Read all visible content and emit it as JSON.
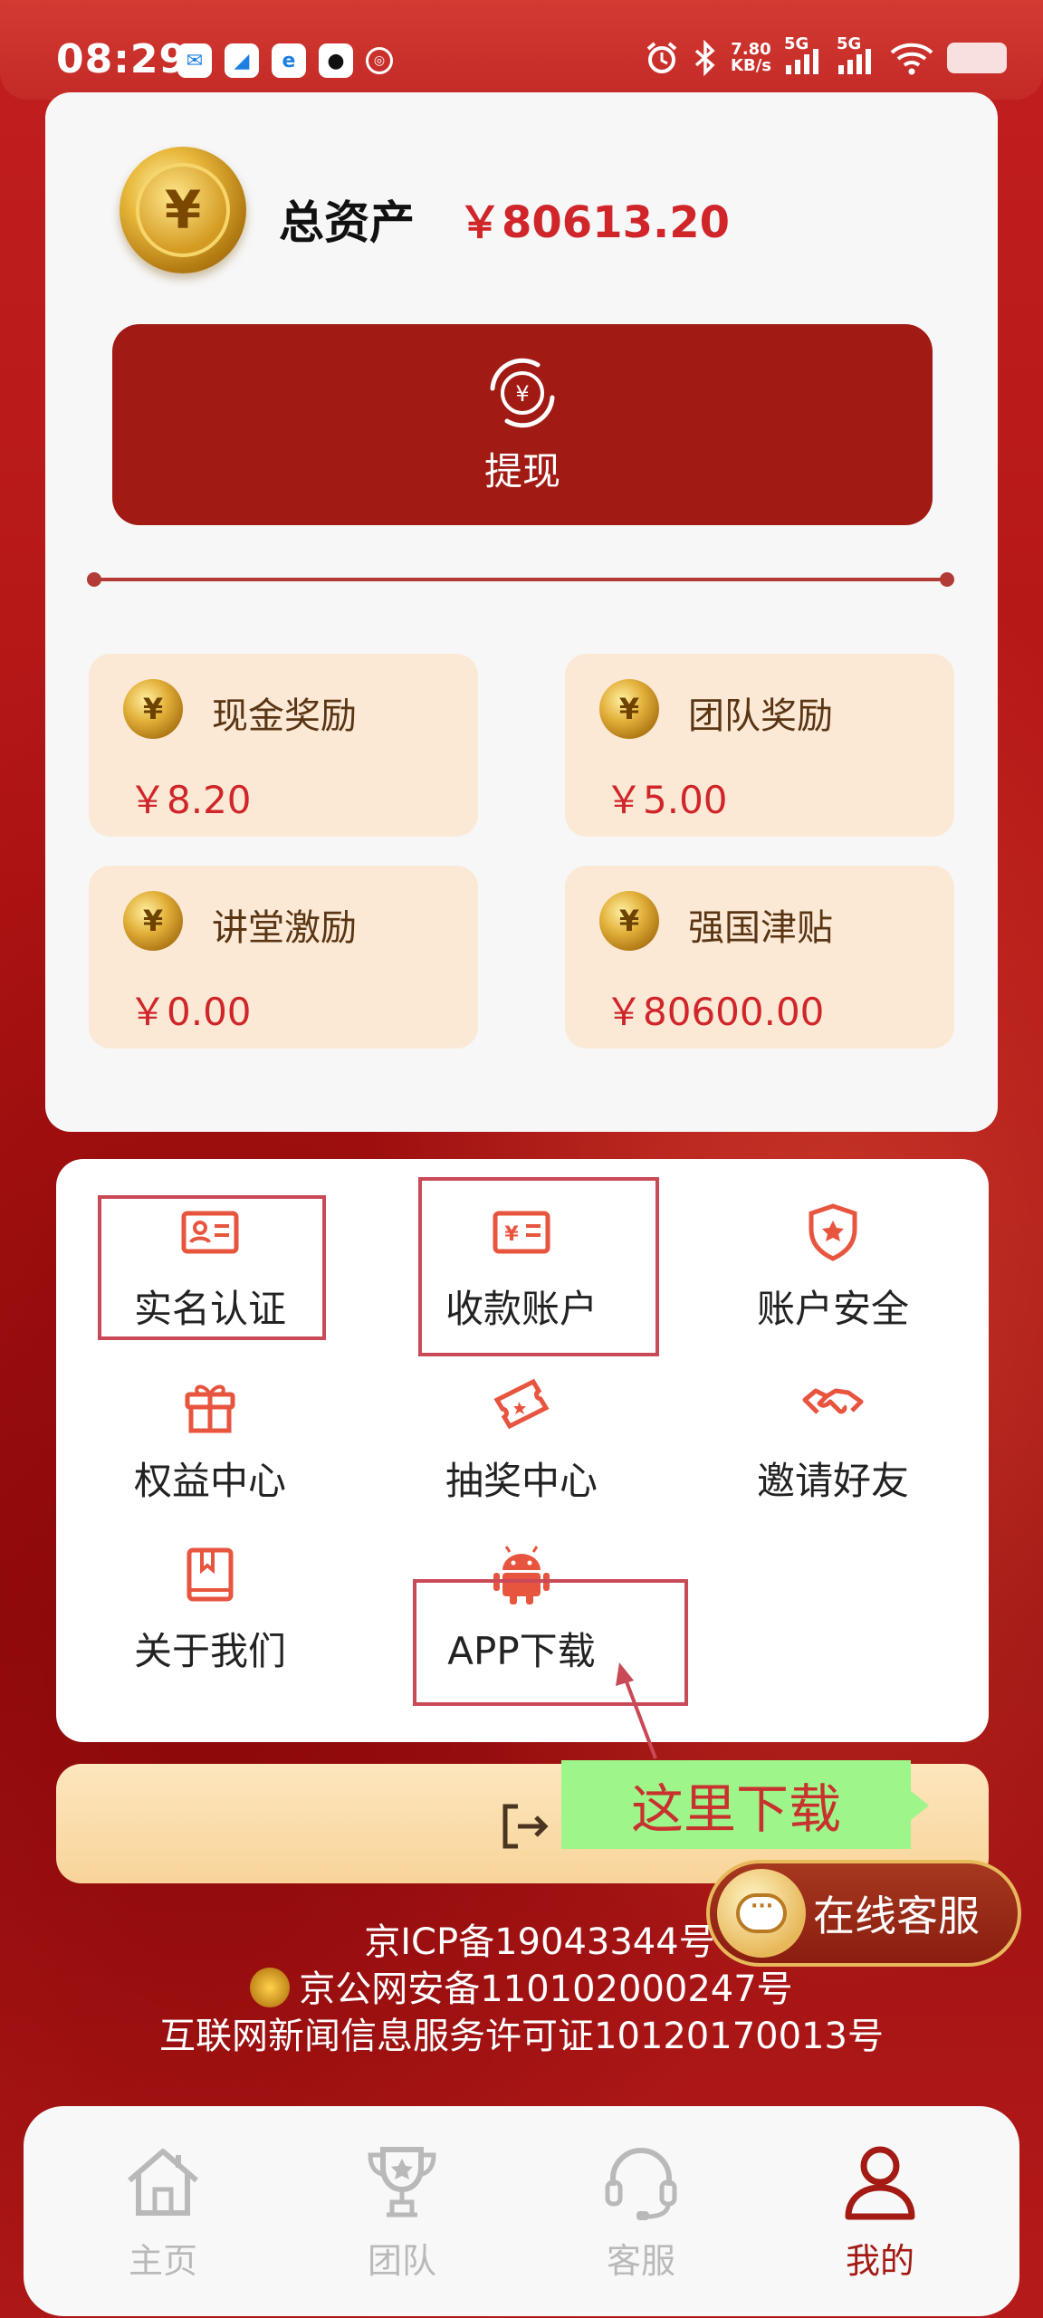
{
  "status_bar": {
    "time": "08:29",
    "net_speed_value": "7.80",
    "net_speed_unit": "KB/s",
    "signal_1": "5G",
    "signal_2": "5G",
    "icons": [
      "alarm-icon",
      "bluetooth-icon",
      "signal-icon",
      "wifi-icon",
      "battery-icon"
    ]
  },
  "assets": {
    "total_label": "总资产",
    "total_value": "￥80613.20",
    "currency_icon": "yen-coin-icon",
    "withdraw_label": "提现"
  },
  "rewards": [
    {
      "label": "现金奖励",
      "value": "￥8.20"
    },
    {
      "label": "团队奖励",
      "value": "￥5.00"
    },
    {
      "label": "讲堂激励",
      "value": "￥0.00"
    },
    {
      "label": "强国津贴",
      "value": "￥80600.00"
    }
  ],
  "menu": [
    {
      "label": "实名认证",
      "icon": "id-card-icon"
    },
    {
      "label": "收款账户",
      "icon": "yen-card-icon"
    },
    {
      "label": "账户安全",
      "icon": "shield-icon"
    },
    {
      "label": "权益中心",
      "icon": "gift-icon"
    },
    {
      "label": "抽奖中心",
      "icon": "ticket-icon"
    },
    {
      "label": "邀请好友",
      "icon": "handshake-icon"
    },
    {
      "label": "关于我们",
      "icon": "book-icon"
    },
    {
      "label": "APP下载",
      "icon": "android-icon"
    }
  ],
  "logout_label": "退",
  "annotation_text": "这里下载",
  "online_service_label": "在线客服",
  "footer": {
    "icp": "京ICP备19043344号",
    "police": "京公网安备110102000247号",
    "news_license": "互联网新闻信息服务许可证10120170013号"
  },
  "nav": [
    {
      "label": "主页",
      "icon": "home-icon",
      "active": false
    },
    {
      "label": "团队",
      "icon": "trophy-icon",
      "active": false
    },
    {
      "label": "客服",
      "icon": "headset-icon",
      "active": false
    },
    {
      "label": "我的",
      "icon": "user-icon",
      "active": true
    }
  ],
  "colors": {
    "primary_red": "#a21a14",
    "price_red": "#d0262a",
    "reward_bg": "#fbe9d6",
    "highlight_box": "#c94a56",
    "annotation_bg": "#9ef58a"
  }
}
